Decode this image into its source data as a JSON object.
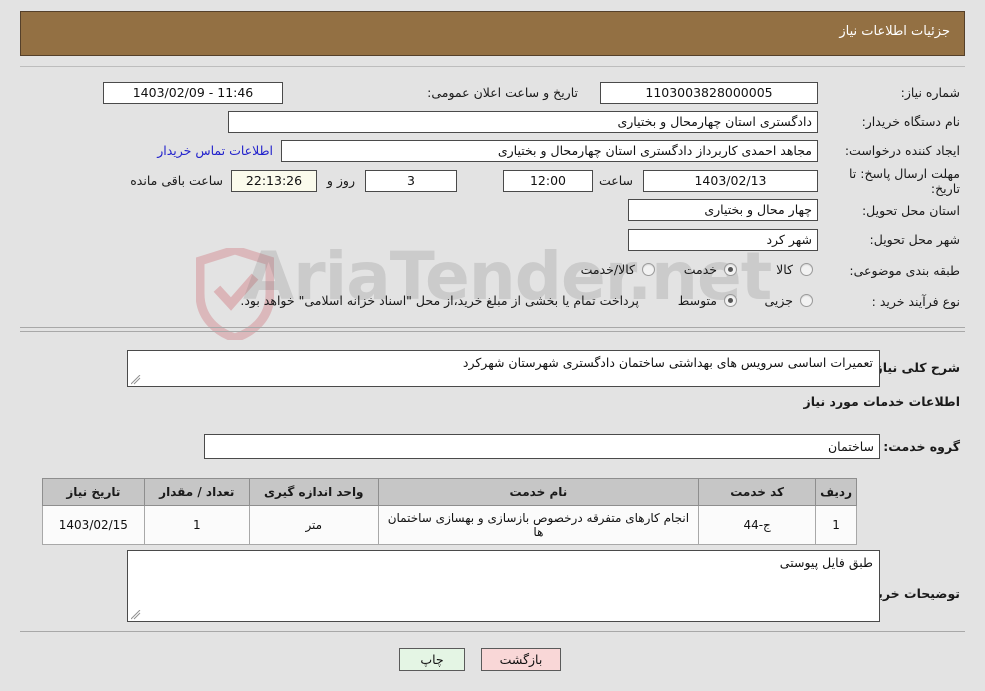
{
  "header": {
    "title": "جزئیات اطلاعات نیاز"
  },
  "watermark": {
    "text": "AriaTender.net"
  },
  "fields": {
    "need_number_label": "شماره نیاز:",
    "need_number_value": "1103003828000005",
    "announce_label": "تاریخ و ساعت اعلان عمومی:",
    "announce_value": "1403/02/09 - 11:46",
    "buyer_org_label": "نام دستگاه خریدار:",
    "buyer_org_value": "دادگستری استان چهارمحال و بختیاری",
    "creator_label": "ایجاد کننده درخواست:",
    "creator_value": "مجاهد احمدی کاربرداز دادگستری استان چهارمحال و بختیاری",
    "contact_link": "اطلاعات تماس خریدار",
    "deadline_label": "مهلت ارسال پاسخ: تا تاریخ:",
    "deadline_date": "1403/02/13",
    "hour_label": "ساعت",
    "deadline_hour": "12:00",
    "days_value": "3",
    "days_label": "روز و",
    "timer_value": "22:13:26",
    "timer_label": "ساعت باقی مانده",
    "province_label": "استان محل تحویل:",
    "province_value": "چهار محال و بختیاری",
    "city_label": "شهر محل تحویل:",
    "city_value": "شهر کرد",
    "category_label": "طبقه بندی موضوعی:",
    "process_label": "نوع فرآیند خرید :",
    "process_note": "پرداخت تمام یا بخشی از مبلغ خرید،از محل \"اسناد خزانه اسلامی\" خواهد بود."
  },
  "category_options": [
    {
      "label": "کالا",
      "selected": false
    },
    {
      "label": "خدمت",
      "selected": true
    },
    {
      "label": "کالا/خدمت",
      "selected": false
    }
  ],
  "process_options": [
    {
      "label": "جزیی",
      "selected": false
    },
    {
      "label": "متوسط",
      "selected": true
    }
  ],
  "description": {
    "label": "شرح کلی نیاز:",
    "value": "تعمیرات اساسی سرویس های بهداشتی ساختمان دادگستری شهرستان شهرکرد"
  },
  "services_section": {
    "heading": "اطلاعات خدمات مورد نیاز",
    "group_label": "گروه خدمت:",
    "group_value": "ساختمان"
  },
  "table": {
    "columns": [
      "ردیف",
      "کد خدمت",
      "نام خدمت",
      "واحد اندازه گیری",
      "تعداد / مقدار",
      "تاریخ نیاز"
    ],
    "rows": [
      {
        "row": "1",
        "code": "ج-44",
        "name": "انجام کارهای متفرقه درخصوص بازسازی و بهسازی ساختمان ها",
        "unit": "متر",
        "qty": "1",
        "date": "1403/02/15"
      }
    ]
  },
  "buyer_notes": {
    "label": "توضیحات خریدار:",
    "value": "طبق فایل پیوستی"
  },
  "buttons": {
    "print": "چاپ",
    "back": "بازگشت"
  },
  "colors": {
    "header_bg": "#937043",
    "page_bg": "#e3e3e3",
    "link": "#2222cc",
    "timer_bg": "#fbfbec",
    "print_bg": "#e4f5e4",
    "back_bg": "#f9d7d7",
    "table_header_bg": "#c6c6c6"
  }
}
